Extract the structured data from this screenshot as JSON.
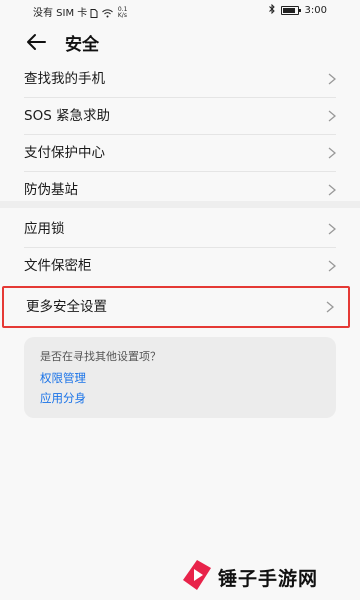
{
  "status_bar": {
    "left_text": "没有 SIM 卡",
    "net_speed_value": "0.1",
    "net_speed_unit": "K/s",
    "time": "3:00"
  },
  "header": {
    "title": "安全"
  },
  "groups": [
    {
      "items": [
        {
          "label": "查找我的手机"
        },
        {
          "label": "SOS 紧急求助"
        },
        {
          "label": "支付保护中心"
        },
        {
          "label": "防伪基站"
        }
      ]
    },
    {
      "items": [
        {
          "label": "应用锁"
        },
        {
          "label": "文件保密柜"
        },
        {
          "label": "更多安全设置",
          "highlighted": true
        }
      ]
    }
  ],
  "suggestion": {
    "question": "是否在寻找其他设置项？",
    "links": [
      "权限管理",
      "应用分身"
    ]
  },
  "watermark": {
    "text": "锤子手游网"
  },
  "colors": {
    "highlight": "#e53935",
    "link": "#1a73e8",
    "background": "#f8f8f8"
  }
}
